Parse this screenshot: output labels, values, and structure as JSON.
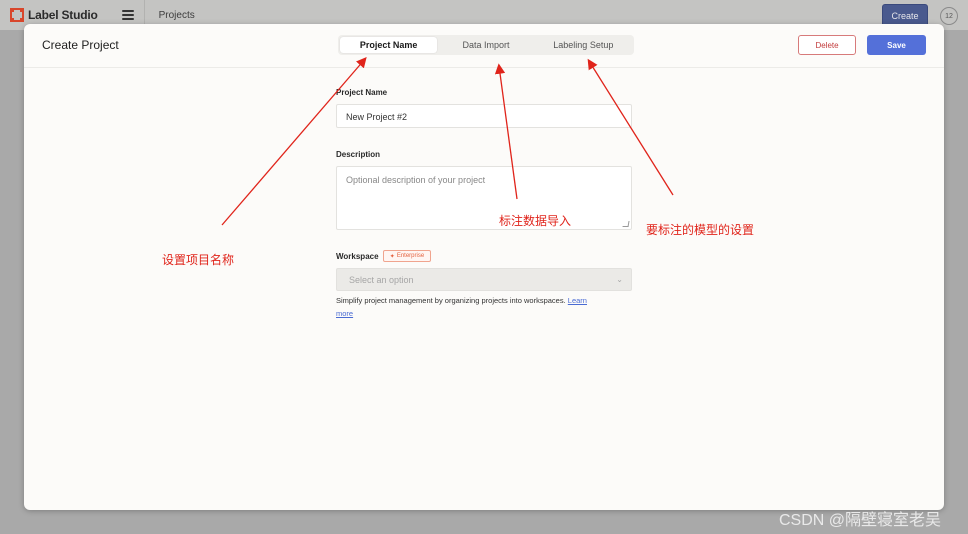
{
  "topbar": {
    "logo_text": "Label Studio",
    "breadcrumb": "Projects",
    "create_label": "Create",
    "avatar_text": "12"
  },
  "modal": {
    "title": "Create Project",
    "tabs": [
      {
        "label": "Project Name",
        "active": true
      },
      {
        "label": "Data Import",
        "active": false
      },
      {
        "label": "Labeling Setup",
        "active": false
      }
    ],
    "delete_label": "Delete",
    "save_label": "Save"
  },
  "form": {
    "name_label": "Project Name",
    "name_value": "New Project #2",
    "description_label": "Description",
    "description_placeholder": "Optional description of your project",
    "workspace_label": "Workspace",
    "enterprise_badge": "Enterprise",
    "workspace_placeholder": "Select an option",
    "help_text": "Simplify project management by organizing projects into workspaces.",
    "help_link_learn": "Learn",
    "help_link_more": "more"
  },
  "annotations": {
    "project_name": "设置项目名称",
    "data_import": "标注数据导入",
    "labeling_setup": "要标注的模型的设置",
    "color": "#e0241b"
  },
  "watermark": "CSDN @隔壁寝室老吴",
  "colors": {
    "primary": "#5470d9",
    "danger": "#c23b3b",
    "enterprise": "#e4623f"
  }
}
